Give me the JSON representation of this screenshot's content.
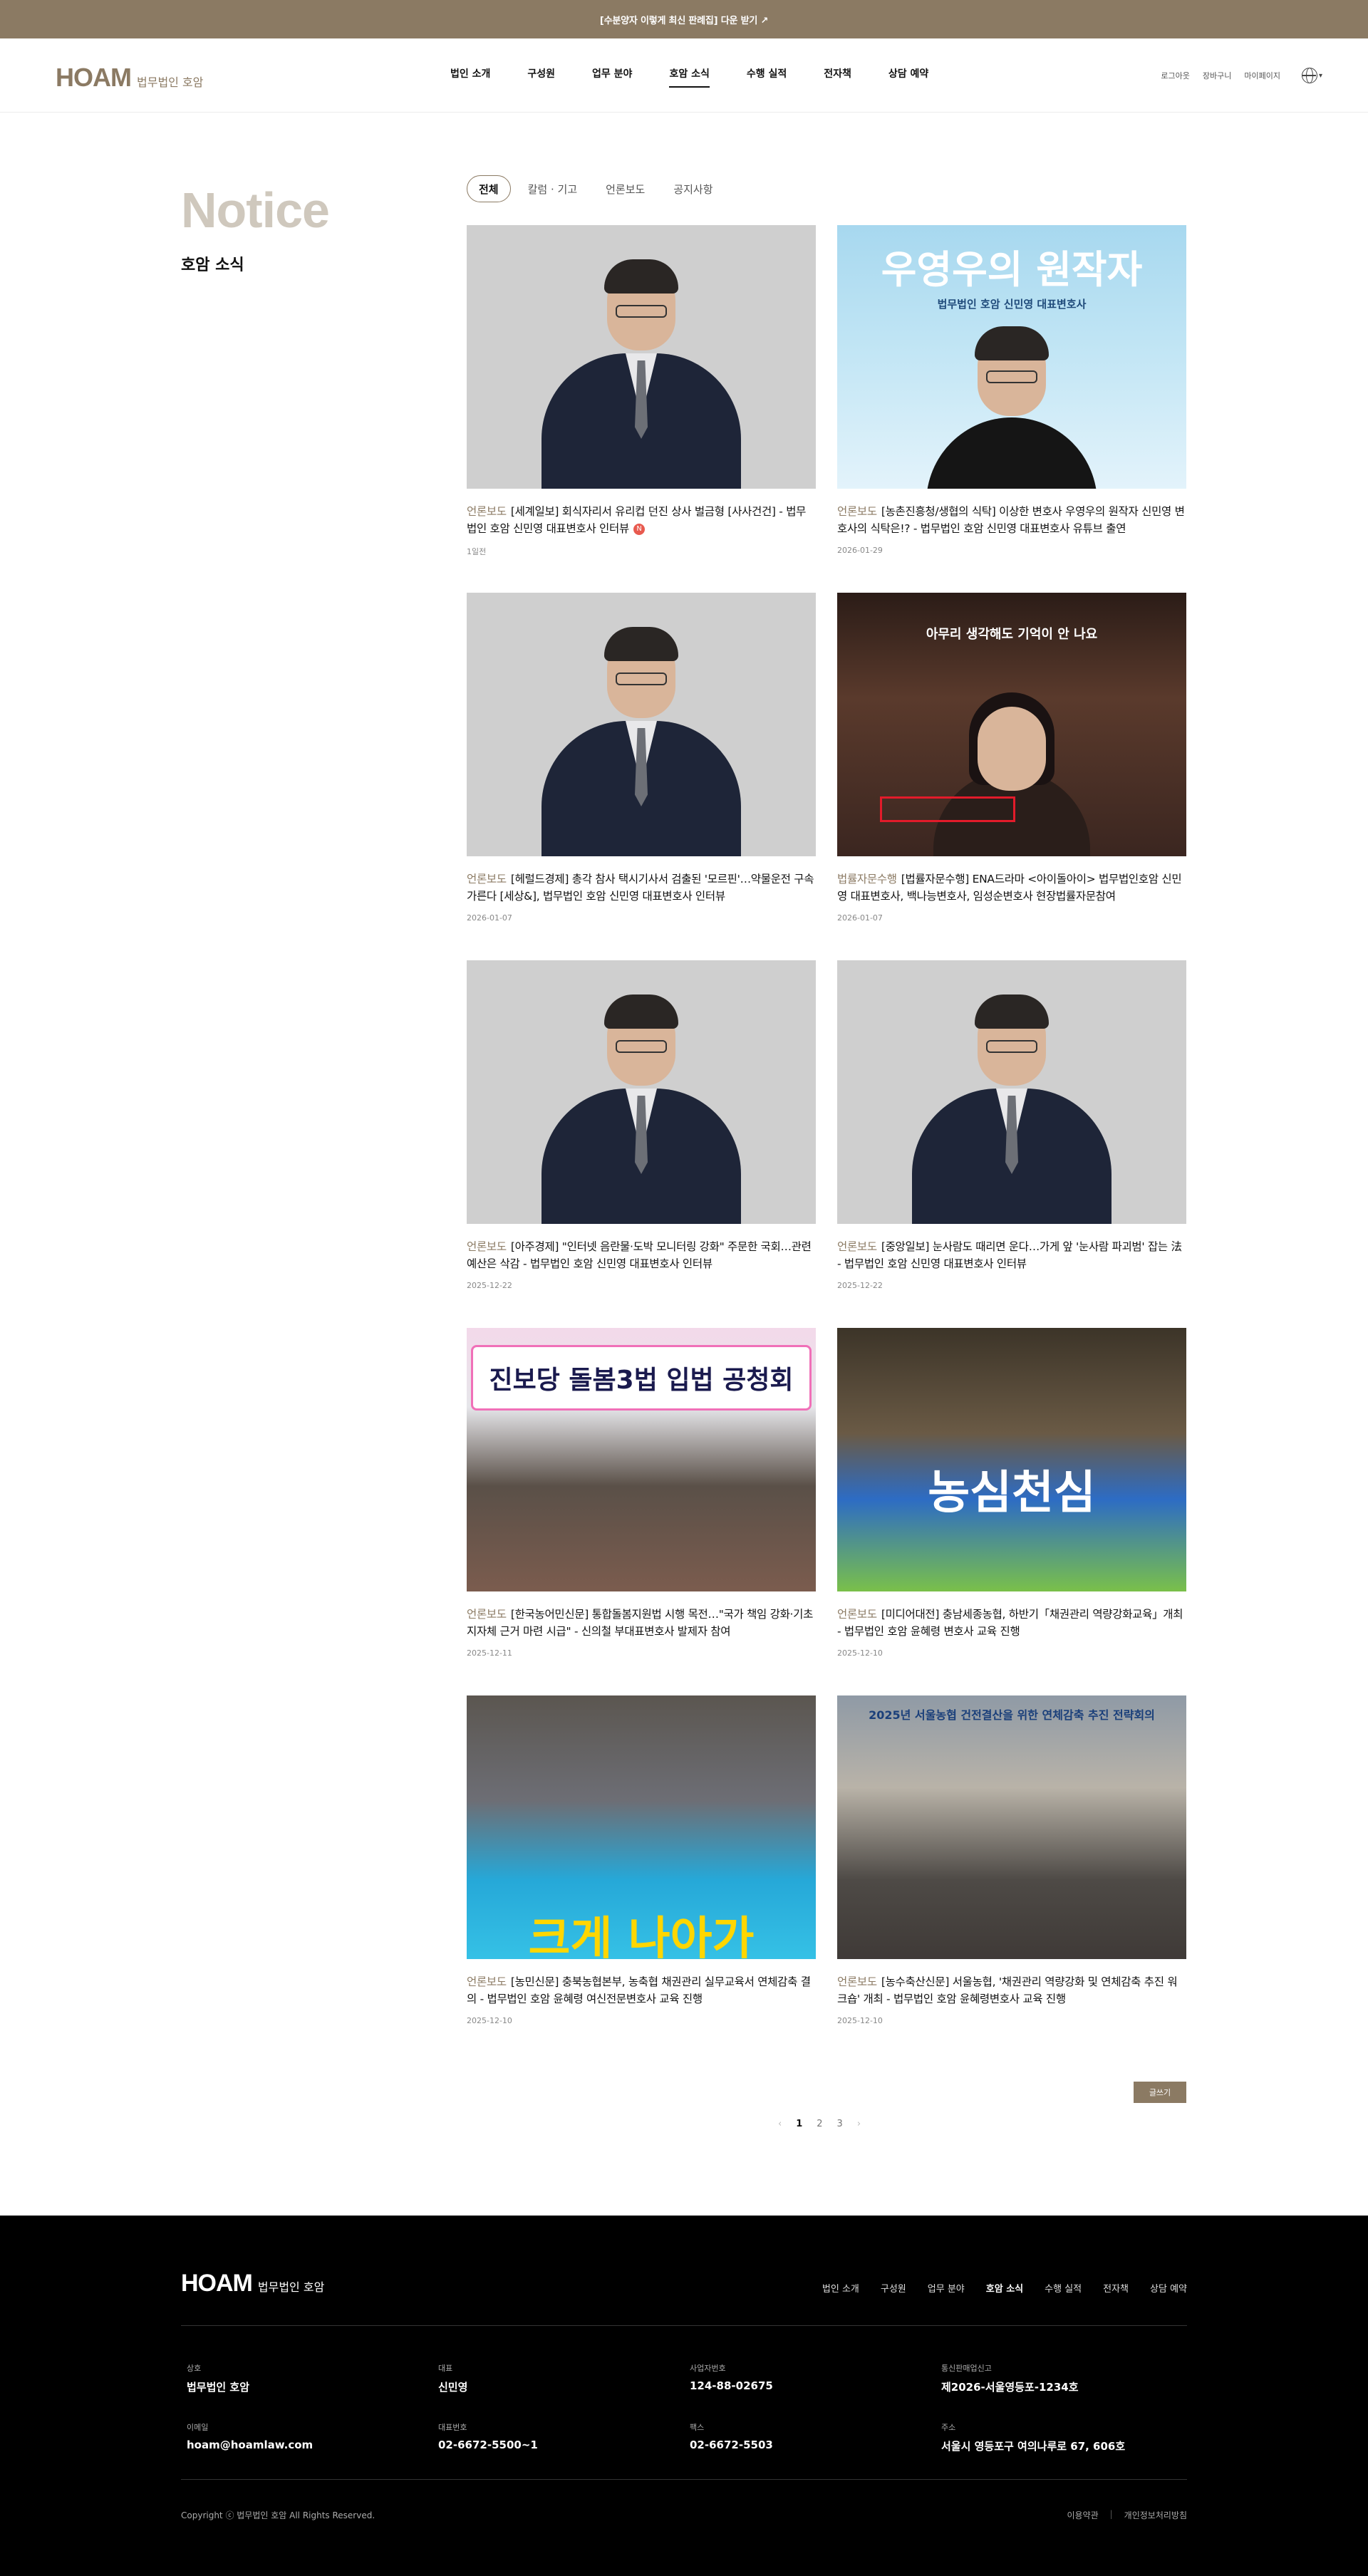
{
  "banner": {
    "text": "[수분양자 이렇게 최신 판례집] 다운 받기 ↗"
  },
  "header": {
    "logo_mark": "HOAM",
    "logo_sub": "법무법인 호암",
    "nav": [
      "법인 소개",
      "구성원",
      "업무 분야",
      "호암 소식",
      "수행 실적",
      "전자책",
      "상담 예약"
    ],
    "active_nav": "호암 소식",
    "util": {
      "login": "로그아웃",
      "cart": "장바구니",
      "mypage": "마이페이지"
    }
  },
  "page": {
    "title": "Notice",
    "subtitle": "호암 소식"
  },
  "tabs": [
    "전체",
    "칼럼 · 기고",
    "언론보도",
    "공지사항"
  ],
  "active_tab": "전체",
  "posts": [
    {
      "category": "언론보도",
      "title": "[세계일보] 회식자리서 유리컵 던진 상사 벌금형 [사사건건] - 법무법인 호암 신민영 대표변호사 인터뷰",
      "date": "1일전",
      "is_new": true,
      "new_label": "N"
    },
    {
      "category": "언론보도",
      "title": "[농촌진흥청/생협의 식탁] 이상한 변호사 우영우의 원작자 신민영 변호사의 식탁은!? - 법무법인 호암 신민영 대표변호사 유튜브 출연",
      "date": "2026-01-29",
      "overlay1": "우영우의 원작자",
      "overlay2": "법무법인 호암 신민영 대표변호사"
    },
    {
      "category": "언론보도",
      "title": "[헤럴드경제] 총각 참사 택시기사서 검출된 '모르핀'…약물운전 구속 가른다 [세상&], 법무법인 호암 신민영 대표변호사 인터뷰",
      "date": "2026-01-07"
    },
    {
      "category": "법률자문수행",
      "title": "[법률자문수행] ENA드라마 <아이돌아이> 법무법인호암 신민영 대표변호사, 백나능변호사, 임성순변호사 현장법률자문참여",
      "date": "2026-01-07",
      "overlay1": "아무리 생각해도 기억이 안 나요"
    },
    {
      "category": "언론보도",
      "title": "[아주경제] \"인터넷 음란물·도박 모니터링 강화\" 주문한 국회…관련 예산은 삭감 - 법무법인 호암 신민영 대표변호사 인터뷰",
      "date": "2025-12-22"
    },
    {
      "category": "언론보도",
      "title": "[중앙일보] 눈사람도 때리면 운다…가게 앞 '눈사람 파괴범' 잡는 法 - 법무법인 호암 신민영 대표변호사 인터뷰",
      "date": "2025-12-22"
    },
    {
      "category": "언론보도",
      "title": "[한국농어민신문] 통합돌봄지원법 시행 목전…\"국가 책임 강화·기초지자체 근거 마련 시급\" - 신의철 부대표변호사 발제자 참여",
      "date": "2025-12-11",
      "overlay1": "진보당 돌봄3법 입법 공청회"
    },
    {
      "category": "언론보도",
      "title": "[미디어대전] 충남세종농협, 하반기「채권관리 역량강화교육」개최 - 법무법인 호암 윤혜령 변호사 교육 진행",
      "date": "2025-12-10",
      "overlay1": "농심천심"
    },
    {
      "category": "언론보도",
      "title": "[농민신문] 충북농협본부, 농축협 채권관리 실무교육서 연체감축 결의 - 법무법인 호암 윤혜령 여신전문변호사 교육 진행",
      "date": "2025-12-10",
      "overlay1": "크게 나아가"
    },
    {
      "category": "언론보도",
      "title": "[농수축산신문] 서울농협, '채권관리 역량강화 및 연체감축 추진 워크숍' 개최 - 법무법인 호암 윤혜령변호사 교육 진행",
      "date": "2025-12-10",
      "overlay1": "2025년 서울농협 건전결산을 위한 연체감축 추진 전략회의"
    }
  ],
  "write_button": "글쓰기",
  "pagination": {
    "prev": "‹",
    "pages": [
      "1",
      "2",
      "3"
    ],
    "current": "1",
    "next": "›"
  },
  "footer": {
    "logo_mark": "HOAM",
    "logo_sub": "법무법인 호암",
    "nav": [
      "법인 소개",
      "구성원",
      "업무 분야",
      "호암 소식",
      "수행 실적",
      "전자책",
      "상담 예약"
    ],
    "active_nav": "호암 소식",
    "info": [
      {
        "label": "상호",
        "value": "법무법인 호암"
      },
      {
        "label": "대표",
        "value": "신민영"
      },
      {
        "label": "사업자번호",
        "value": "124-88-02675"
      },
      {
        "label": "통신판매업신고",
        "value": "제2026-서울영등포-1234호"
      },
      {
        "label": "이메일",
        "value": "hoam@hoamlaw.com"
      },
      {
        "label": "대표번호",
        "value": "02-6672-5500~1"
      },
      {
        "label": "팩스",
        "value": "02-6672-5503"
      },
      {
        "label": "주소",
        "value": "서울시 영등포구 여의나루로 67, 606호"
      }
    ],
    "copyright": "Copyright ⓒ 법무법인 호암 All Rights Reserved.",
    "links": [
      "이용약관",
      "개인정보처리방침"
    ]
  },
  "colors": {
    "brand": "#8b7a63",
    "title_light": "#cfc8bd",
    "footer_bg": "#000000"
  }
}
